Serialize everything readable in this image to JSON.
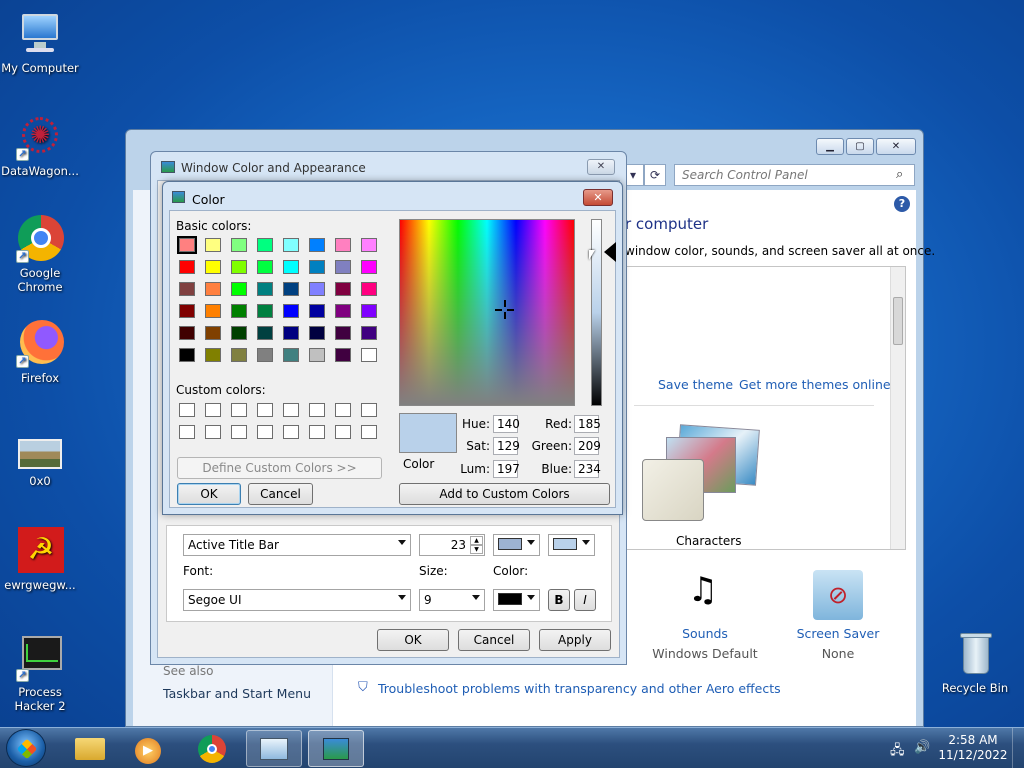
{
  "desktop": {
    "icons": [
      {
        "label": "My Computer",
        "glyph": "🖥"
      },
      {
        "label": "DataWagon...",
        "glyph": "✺"
      },
      {
        "label": "Google Chrome",
        "glyph": ""
      },
      {
        "label": "Firefox",
        "glyph": ""
      },
      {
        "label": "0x0",
        "glyph": ""
      },
      {
        "label": "ewrgwegw...",
        "glyph": "☭"
      },
      {
        "label": "Process Hacker 2",
        "glyph": "📈"
      },
      {
        "label": "Recycle Bin",
        "glyph": "🗑"
      }
    ]
  },
  "control_panel": {
    "search_placeholder": "Search Control Panel",
    "heading": "r computer",
    "subheading": "window color, sounds, and screen saver all at once.",
    "save_theme": "Save theme",
    "get_more_themes": "Get more themes online",
    "theme_name": "Characters",
    "sounds_label": "Sounds",
    "sounds_value": "Windows Default",
    "screensaver_label": "Screen Saver",
    "screensaver_value": "None",
    "see_also": "See also",
    "taskbar_link": "Taskbar and Start Menu",
    "troubleshoot": "Troubleshoot problems with transparency and other Aero effects"
  },
  "window_color": {
    "title": "Window Color and Appearance",
    "item_value": "Active Title Bar",
    "size_value": "23",
    "font_label": "Font:",
    "size_label": "Size:",
    "color_label": "Color:",
    "font_value": "Segoe UI",
    "font_size_value": "9",
    "bold": "B",
    "italic": "I",
    "ok": "OK",
    "cancel": "Cancel",
    "apply": "Apply"
  },
  "color_dialog": {
    "title": "Color",
    "basic_colors_label": "Basic colors:",
    "custom_colors_label": "Custom colors:",
    "define_custom": "Define Custom Colors >>",
    "ok": "OK",
    "cancel": "Cancel",
    "add_custom": "Add to Custom Colors",
    "color_label": "Color",
    "hue_label": "Hue:",
    "hue": "140",
    "sat_label": "Sat:",
    "sat": "129",
    "lum_label": "Lum:",
    "lum": "197",
    "red_label": "Red:",
    "red": "185",
    "green_label": "Green:",
    "green": "209",
    "blue_label": "Blue:",
    "blue": "234",
    "selected_color": "#b9d1ea",
    "basic_colors": [
      "#ff8080",
      "#ffff80",
      "#80ff80",
      "#00ff80",
      "#80ffff",
      "#0080ff",
      "#ff80c0",
      "#ff80ff",
      "#ff0000",
      "#ffff00",
      "#80ff00",
      "#00ff40",
      "#00ffff",
      "#0080c0",
      "#8080c0",
      "#ff00ff",
      "#804040",
      "#ff8040",
      "#00ff00",
      "#008080",
      "#004080",
      "#8080ff",
      "#800040",
      "#ff0080",
      "#800000",
      "#ff8000",
      "#008000",
      "#008040",
      "#0000ff",
      "#0000a0",
      "#800080",
      "#8000ff",
      "#400000",
      "#804000",
      "#004000",
      "#004040",
      "#000080",
      "#000040",
      "#400040",
      "#400080",
      "#000000",
      "#808000",
      "#808040",
      "#808080",
      "#408080",
      "#c0c0c0",
      "#400040",
      "#ffffff"
    ]
  },
  "taskbar": {
    "time": "2:58 AM",
    "date": "11/12/2022"
  }
}
